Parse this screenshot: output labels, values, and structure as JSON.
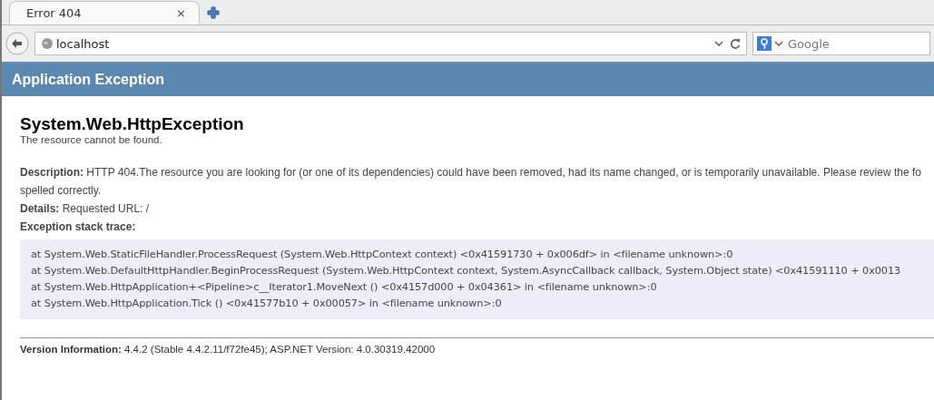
{
  "tabs": [
    {
      "label": "Error 404",
      "selected": true,
      "close": "×"
    }
  ],
  "address_bar": {
    "value": "localhost"
  },
  "search_box": {
    "placeholder": "Google"
  },
  "header": {
    "title": "Application Exception"
  },
  "error": {
    "title": "System.Web.HttpException",
    "subtitle": "The resource cannot be found.",
    "description": "**Description:** HTTP 404.The resource you are looking for (or one of its dependencies) could have been removed, had its name changed, or is temporarily unavailable. Please review the fo",
    "description_continued": "spelled correctly.",
    "details": "**Details:** Requested URL: /",
    "stack_heading": "Exception stack trace:",
    "stack_trace": [
      "at System.Web.StaticFileHandler.ProcessRequest (System.Web.HttpContext context) <0x41591730 + 0x006df> in <filename unknown>:0",
      "at System.Web.DefaultHttpHandler.BeginProcessRequest (System.Web.HttpContext context, System.AsyncCallback callback, System.Object state) <0x41591110 + 0x0013",
      "at System.Web.HttpApplication+<Pipeline>c__Iterator1.MoveNext () <0x4157d000 + 0x04361> in <filename unknown>:0",
      "at System.Web.HttpApplication.Tick () <0x41577b10 + 0x00057> in <filename unknown>:0"
    ],
    "version": "**Version Information:** 4.4.2 (Stable 4.4.2.11/f72fe45); ASP.NET Version: 4.0.30319.42000"
  }
}
